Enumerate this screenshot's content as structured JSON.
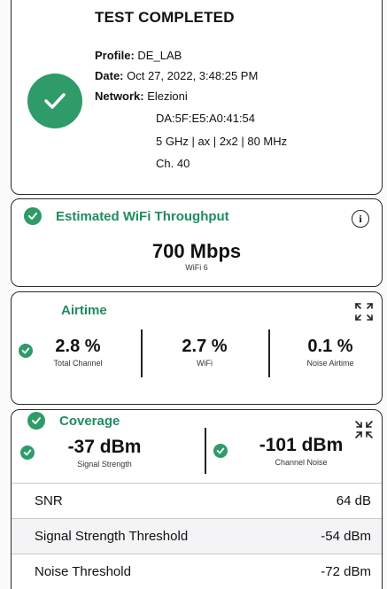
{
  "summary": {
    "title": "TEST COMPLETED",
    "profile_label": "Profile:",
    "profile_value": "DE_LAB",
    "date_label": "Date:",
    "date_value": "Oct 27, 2022, 3:48:25 PM",
    "network_label": "Network:",
    "network_value": "Elezioni",
    "bssid": "DA:5F:E5:A0:41:54",
    "radio": "5 GHz | ax | 2x2 | 80 MHz",
    "channel": "Ch. 40"
  },
  "throughput": {
    "title": "Estimated WiFi Throughput",
    "value": "700 Mbps",
    "standard": "WiFi 6"
  },
  "airtime": {
    "title": "Airtime",
    "metrics": [
      {
        "value": "2.8 %",
        "label": "Total Channel"
      },
      {
        "value": "2.7 %",
        "label": "WiFi"
      },
      {
        "value": "0.1 %",
        "label": "Noise Airtime"
      }
    ]
  },
  "coverage": {
    "title": "Coverage",
    "signal_value": "-37 dBm",
    "signal_label": "Signal Strength",
    "noise_value": "-101 dBm",
    "noise_label": "Channel Noise",
    "rows": [
      {
        "label": "SNR",
        "value": "64 dB"
      },
      {
        "label": "Signal Strength Threshold",
        "value": "-54 dBm"
      },
      {
        "label": "Noise Threshold",
        "value": "-72 dBm"
      }
    ]
  },
  "colors": {
    "accent": "#2e9b68",
    "accent_text": "#1f8d5e"
  }
}
